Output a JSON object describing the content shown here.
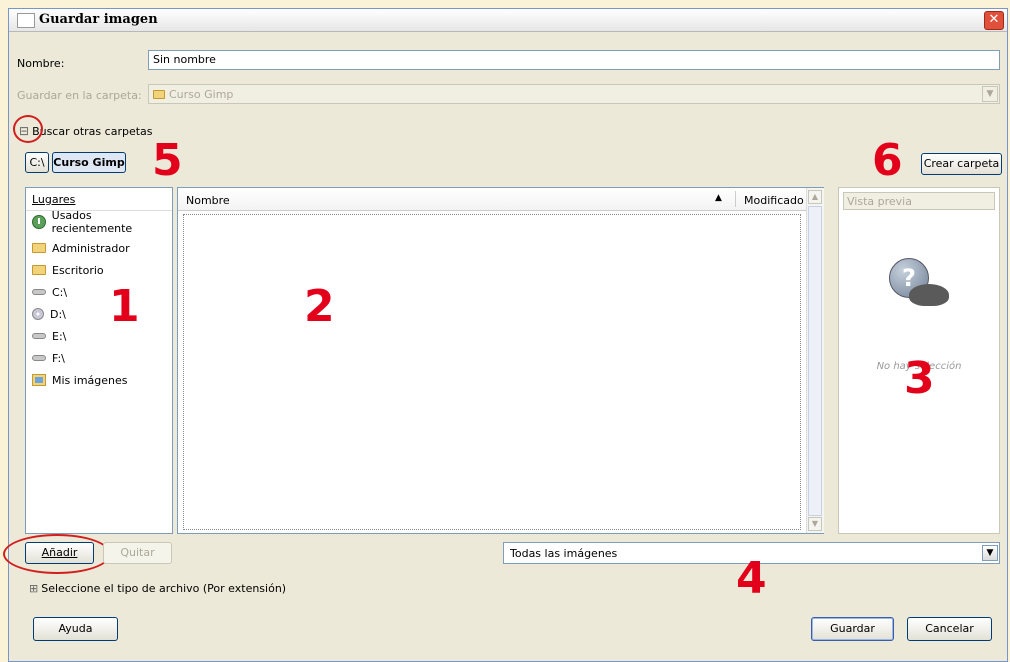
{
  "window": {
    "title": "Guardar imagen",
    "close_glyph": "✕"
  },
  "name_row": {
    "label": "Nombre:",
    "value": "Sin nombre"
  },
  "folder_row": {
    "label": "Guardar en la carpeta:",
    "value": "Curso Gimp"
  },
  "browse": {
    "toggle_glyph": "⊟",
    "label": "Buscar otras carpetas"
  },
  "path_bar": {
    "items": [
      "C:\\",
      "Curso Gimp"
    ]
  },
  "create_folder_button": "Crear carpeta",
  "places": {
    "header": "Lugares",
    "items": [
      {
        "label": "Usados recientemente",
        "icon": "clock-icon"
      },
      {
        "label": "Administrador",
        "icon": "folder-icon"
      },
      {
        "label": "Escritorio",
        "icon": "folder-icon"
      },
      {
        "label": "C:\\",
        "icon": "drive-icon"
      },
      {
        "label": "D:\\",
        "icon": "cd-icon"
      },
      {
        "label": "E:\\",
        "icon": "drive-icon"
      },
      {
        "label": "F:\\",
        "icon": "drive-icon"
      },
      {
        "label": "Mis imágenes",
        "icon": "pictures-folder-icon"
      }
    ]
  },
  "files": {
    "columns": [
      "Nombre",
      "Modificado"
    ],
    "sort_glyph": "▲"
  },
  "preview": {
    "header": "Vista previa",
    "message": "No hay selección"
  },
  "buttons": {
    "add": "Añadir",
    "remove": "Quitar",
    "help": "Ayuda",
    "save": "Guardar",
    "cancel": "Cancelar"
  },
  "filter": {
    "value": "Todas las imágenes"
  },
  "file_type": {
    "toggle_glyph": "⊞",
    "label": "Seleccione el tipo de archivo (Por extensión)"
  },
  "annotations": [
    "1",
    "2",
    "3",
    "4",
    "5",
    "6"
  ],
  "colors": {
    "annotation": "#e3001b",
    "window_bg": "#ece9d8",
    "page_bg": "#fbf3d7"
  }
}
